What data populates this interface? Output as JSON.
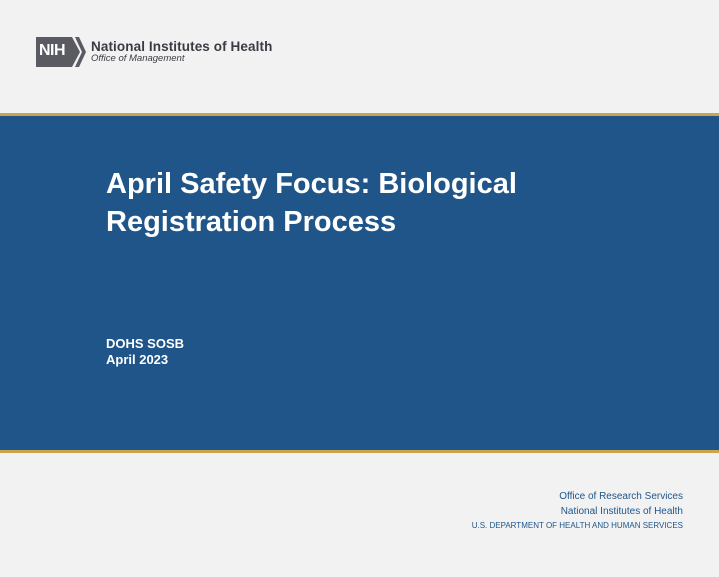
{
  "header": {
    "logo_mark": "NIH",
    "logo_title": "National Institutes of Health",
    "logo_subtitle": "Office of Management"
  },
  "banner": {
    "title_line1": "April Safety Focus: Biological",
    "title_line2": "Registration Process",
    "presenter": "DOHS SOSB",
    "date": "April 2023"
  },
  "footer": {
    "line1": "Office of Research Services",
    "line2": "National Institutes of Health",
    "line3": "U.S. DEPARTMENT OF HEALTH AND HUMAN SERVICES"
  },
  "colors": {
    "banner_blue": "#1f5589",
    "gold_rule": "#c9a54e",
    "background": "#f2f2f2",
    "logo_gray": "#5a5a63"
  }
}
